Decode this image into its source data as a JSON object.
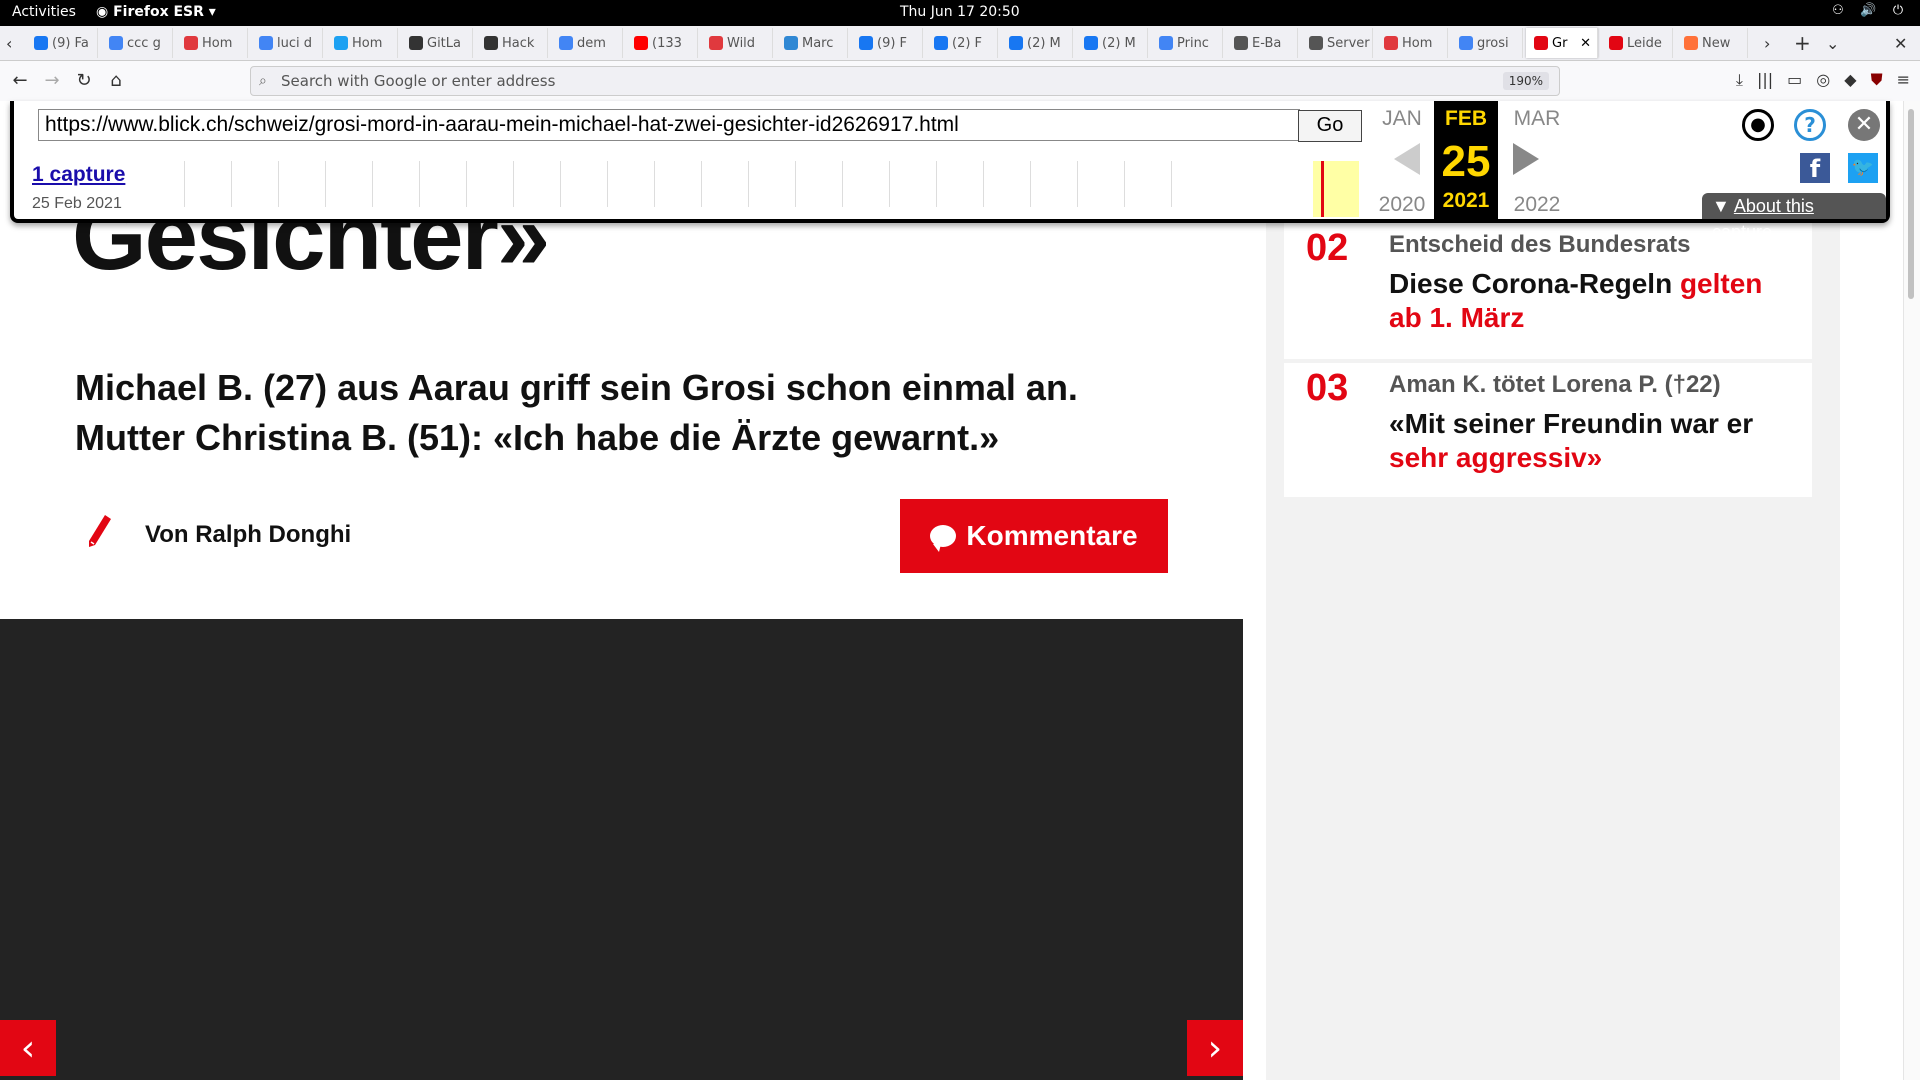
{
  "topbar": {
    "activities": "Activities",
    "app_name": "Firefox ESR",
    "clock": "Thu Jun 17  20:50"
  },
  "tabs": [
    {
      "label": "(9) Fa",
      "favicon": "facebook-icon",
      "color": "#1877f2"
    },
    {
      "label": "ccc g",
      "favicon": "google-icon",
      "color": "#4285f4"
    },
    {
      "label": "Hom",
      "favicon": "mastodon-red-icon",
      "color": "#e0393e"
    },
    {
      "label": "luci d",
      "favicon": "google-icon",
      "color": "#4285f4"
    },
    {
      "label": "Hom",
      "favicon": "twitter-icon",
      "color": "#1da1f2"
    },
    {
      "label": "GitLa",
      "favicon": "gitlab-icon",
      "color": "#333"
    },
    {
      "label": "Hack",
      "favicon": "github-icon",
      "color": "#333"
    },
    {
      "label": "dem",
      "favicon": "google-icon",
      "color": "#4285f4"
    },
    {
      "label": "(133",
      "favicon": "youtube-icon",
      "color": "#ff0000"
    },
    {
      "label": "Wild",
      "favicon": "record-icon",
      "color": "#e0393e"
    },
    {
      "label": "Marc",
      "favicon": "mastodon-icon",
      "color": "#3088d4"
    },
    {
      "label": "(9) F",
      "favicon": "facebook-icon",
      "color": "#1877f2"
    },
    {
      "label": "(2) F",
      "favicon": "facebook-icon",
      "color": "#1877f2"
    },
    {
      "label": "(2) M",
      "favicon": "facebook-icon",
      "color": "#1877f2"
    },
    {
      "label": "(2) M",
      "favicon": "facebook-icon",
      "color": "#1877f2"
    },
    {
      "label": "Princ",
      "favicon": "google-icon",
      "color": "#4285f4"
    },
    {
      "label": "E-Ba",
      "favicon": "gear-icon",
      "color": "#555"
    },
    {
      "label": "Server N",
      "favicon": "",
      "color": "#555"
    },
    {
      "label": "Hom",
      "favicon": "record-icon",
      "color": "#e0393e"
    },
    {
      "label": "grosi",
      "favicon": "google-icon",
      "color": "#4285f4"
    },
    {
      "label": "Gr",
      "favicon": "blick-icon",
      "color": "#e20613",
      "active": true
    },
    {
      "label": "Leide",
      "favicon": "blick-icon",
      "color": "#e20613"
    },
    {
      "label": "New",
      "favicon": "firefox-icon",
      "color": "#ff7139"
    }
  ],
  "navbar": {
    "url_placeholder": "Search with Google or enter address",
    "zoom": "190%"
  },
  "wayback": {
    "url": "https://www.blick.ch/schweiz/grosi-mord-in-aarau-mein-michael-hat-zwei-gesichter-id2626917.html",
    "go": "Go",
    "captures": "1 capture",
    "capture_date": "25 Feb 2021",
    "prev_month": "JAN",
    "cur_month": "FEB",
    "next_month": "MAR",
    "day": "25",
    "prev_year": "2020",
    "cur_year": "2021",
    "next_year": "2022",
    "about": "About this capture"
  },
  "article": {
    "headline_tail": "Gesichter»",
    "lead": "Michael B. (27) aus Aarau griff sein Grosi schon einmal an. Mutter Christina B. (51): «Ich habe die Ärzte gewarnt.»",
    "author": "Von Ralph Donghi",
    "comments_button": "Kommentare"
  },
  "sidebar": {
    "items": [
      {
        "num": "02",
        "kicker": "Entscheid des Bundesrats",
        "title_black": "Diese Corona-Regeln ",
        "title_red": "gelten ab 1. März"
      },
      {
        "num": "03",
        "kicker": "Aman K. tötet Lorena P. (†22)",
        "title_black": "«Mit seiner Freundin war er ",
        "title_red": "sehr aggressiv»"
      }
    ]
  },
  "colors": {
    "brand_red": "#e20613",
    "wayback_gold": "#ffd700",
    "video_bg": "#232323"
  }
}
